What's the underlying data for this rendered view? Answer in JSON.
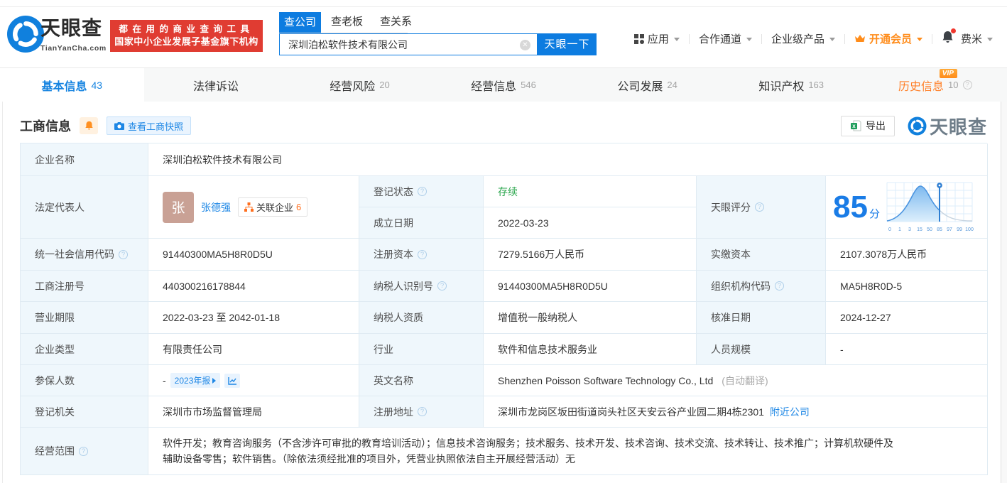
{
  "brand": {
    "name": "天眼查",
    "domain": "TianYanCha.com",
    "slogan_line1": "都在用的商业查询工具",
    "slogan_line2": "国家中小企业发展子基金旗下机构",
    "watermark": "天眼查"
  },
  "search": {
    "tabs": [
      {
        "label": "查公司"
      },
      {
        "label": "查老板"
      },
      {
        "label": "查关系"
      }
    ],
    "input_value": "深圳泊松软件技术有限公司",
    "button_label": "天眼一下"
  },
  "top_menu": {
    "apps": "应用",
    "partner": "合作通道",
    "enterprise": "企业级产品",
    "vip": "开通会员",
    "user": "费米"
  },
  "nav_tabs": [
    {
      "label": "基本信息",
      "count": "43"
    },
    {
      "label": "法律诉讼",
      "count": ""
    },
    {
      "label": "经营风险",
      "count": "20"
    },
    {
      "label": "经营信息",
      "count": "546"
    },
    {
      "label": "公司发展",
      "count": "24"
    },
    {
      "label": "知识产权",
      "count": "163"
    },
    {
      "label": "历史信息",
      "count": "10",
      "vip_badge": "VIP"
    }
  ],
  "section": {
    "title": "工商信息",
    "snapshot_button": "查看工商快照",
    "export_button": "导出"
  },
  "table": {
    "company_name": {
      "label": "企业名称",
      "value": "深圳泊松软件技术有限公司"
    },
    "legal_rep": {
      "label": "法定代表人",
      "avatar": "张",
      "name": "张德强",
      "related": "关联企业",
      "related_count": "6"
    },
    "reg_status": {
      "label": "登记状态",
      "value": "存续"
    },
    "establish_date": {
      "label": "成立日期",
      "value": "2022-03-23"
    },
    "score": {
      "label": "天眼评分",
      "value": "85",
      "unit": "分",
      "ticks": "0 1 3 15 50 85 97 99 100"
    },
    "credit_code": {
      "label": "统一社会信用代码",
      "value": "91440300MA5H8R0D5U"
    },
    "reg_capital": {
      "label": "注册资本",
      "value": "7279.5166万人民币"
    },
    "paid_capital": {
      "label": "实缴资本",
      "value": "2107.3078万人民币"
    },
    "reg_number": {
      "label": "工商注册号",
      "value": "440300216178844"
    },
    "taxpayer_id": {
      "label": "纳税人识别号",
      "value": "91440300MA5H8R0D5U"
    },
    "org_code": {
      "label": "组织机构代码",
      "value": "MA5H8R0D-5"
    },
    "business_term": {
      "label": "营业期限",
      "value": "2022-03-23 至 2042-01-18"
    },
    "taxpayer_quality": {
      "label": "纳税人资质",
      "value": "增值税一般纳税人"
    },
    "approval_date": {
      "label": "核准日期",
      "value": "2024-12-27"
    },
    "company_type": {
      "label": "企业类型",
      "value": "有限责任公司"
    },
    "industry": {
      "label": "行业",
      "value": "软件和信息技术服务业"
    },
    "staff_size": {
      "label": "人员规模",
      "value": "-"
    },
    "insured": {
      "label": "参保人数",
      "value": "-",
      "report_tag": "2023年报"
    },
    "english_name": {
      "label": "英文名称",
      "value": "Shenzhen Poisson Software Technology Co., Ltd",
      "note": "(自动翻译)"
    },
    "reg_authority": {
      "label": "登记机关",
      "value": "深圳市市场监督管理局"
    },
    "reg_address": {
      "label": "注册地址",
      "value": "深圳市龙岗区坂田街道岗头社区天安云谷产业园二期4栋2301",
      "nearby": "附近公司"
    },
    "business_scope": {
      "label": "经营范围",
      "value": "软件开发；教育咨询服务（不含涉许可审批的教育培训活动）；信息技术咨询服务；技术服务、技术开发、技术咨询、技术交流、技术转让、技术推广；计算机软硬件及辅助设备零售；软件销售。（除依法须经批准的项目外，凭营业执照依法自主开展经营活动）无"
    }
  }
}
